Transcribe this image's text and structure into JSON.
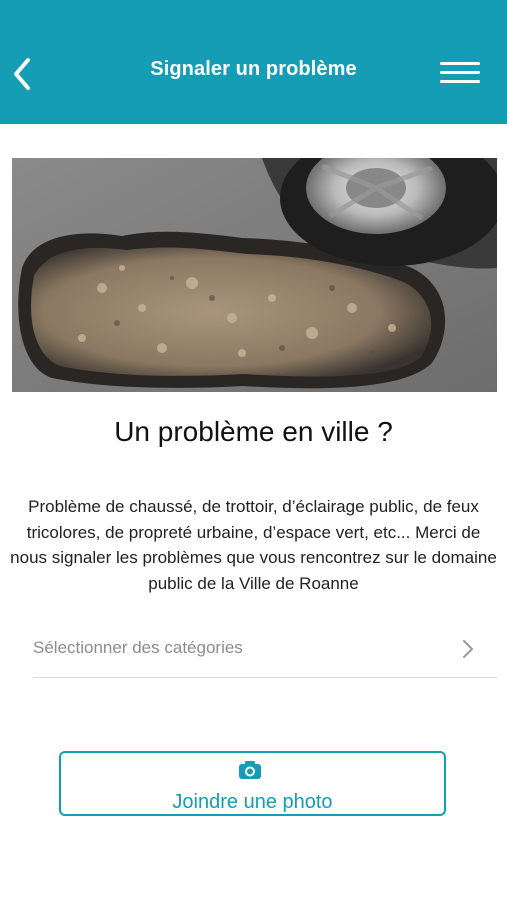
{
  "header": {
    "title": "Signaler un problème",
    "back_icon": "chevron-left-icon",
    "menu_icon": "hamburger-menu-icon"
  },
  "hero": {
    "image_description_icon": "pothole-photo"
  },
  "main": {
    "heading": "Un problème en ville ?",
    "description": "Problème de chaussé, de trottoir, d’éclairage public, de feux tricolores, de propreté urbaine, d’espace vert, etc... Merci de nous signaler les problèmes que vous rencontrez sur le domaine public de la Ville de Roanne"
  },
  "category_selector": {
    "placeholder": "Sélectionner des catégories",
    "icon": "chevron-right-icon"
  },
  "photo_button": {
    "label": "Joindre une photo",
    "icon": "camera-icon"
  },
  "colors": {
    "accent": "#159db6",
    "background": "#ffffff",
    "placeholder_text": "#8c8c8c"
  }
}
